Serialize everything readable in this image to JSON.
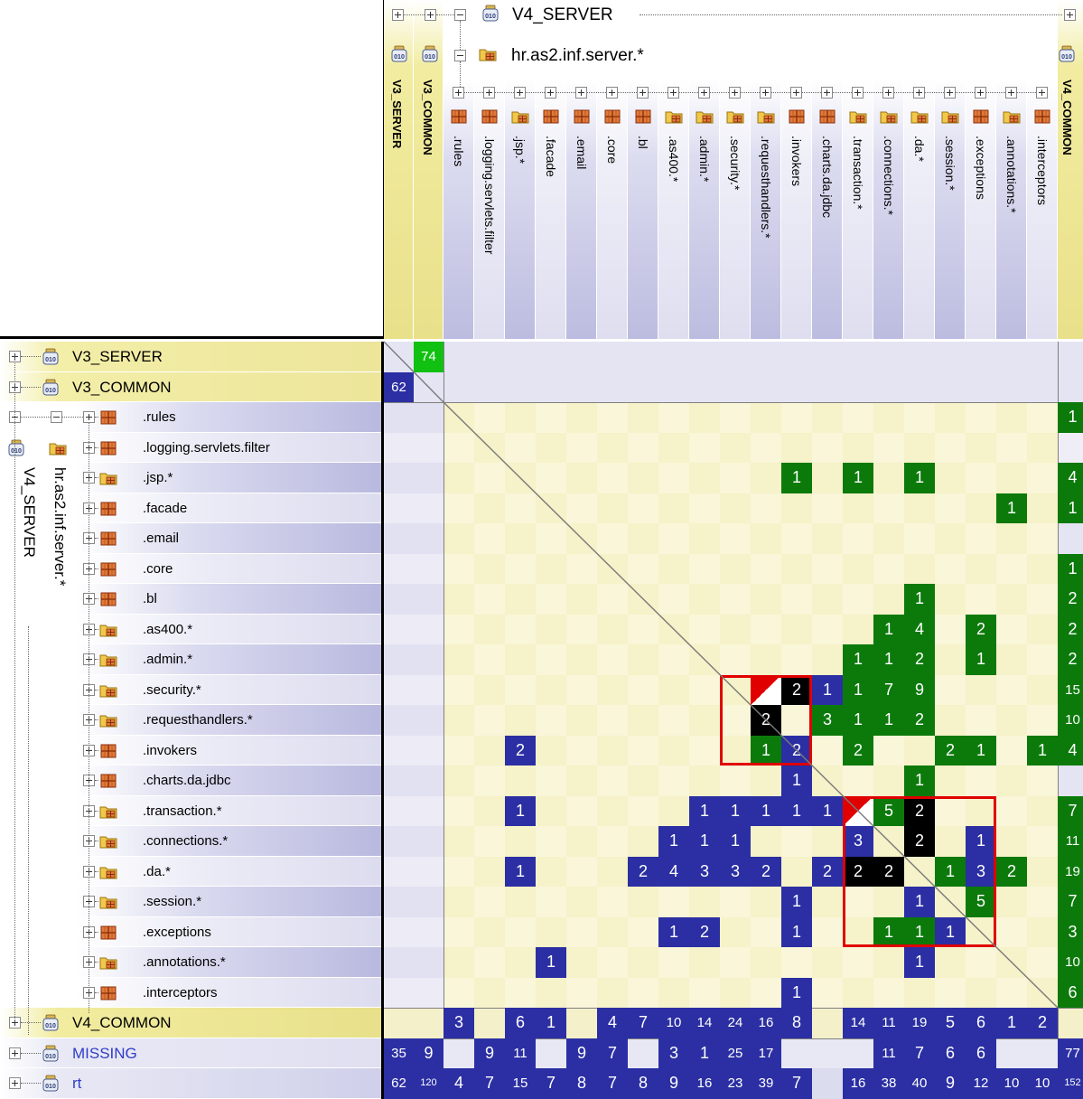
{
  "top_header": {
    "server_module": "V4_SERVER",
    "package": "hr.as2.inf.server.*",
    "left_modules": [
      "V3_SERVER",
      "V3_COMMON"
    ],
    "right_module": "V4_COMMON"
  },
  "row_tree": {
    "server_module": "V4_SERVER",
    "package": "hr.as2.inf.server.*"
  },
  "columns": [
    {
      "label": ".rules",
      "icon": "package-icon"
    },
    {
      "label": ".logging.servlets.filter",
      "icon": "package-icon"
    },
    {
      "label": ".jsp.*",
      "icon": "package-folder-icon"
    },
    {
      "label": ".facade",
      "icon": "package-icon"
    },
    {
      "label": ".email",
      "icon": "package-icon"
    },
    {
      "label": ".core",
      "icon": "package-icon"
    },
    {
      "label": ".bl",
      "icon": "package-icon"
    },
    {
      "label": ".as400.*",
      "icon": "package-folder-icon"
    },
    {
      "label": ".admin.*",
      "icon": "package-folder-icon"
    },
    {
      "label": ".security.*",
      "icon": "package-folder-icon"
    },
    {
      "label": ".requesthandlers.*",
      "icon": "package-folder-icon"
    },
    {
      "label": ".invokers",
      "icon": "package-icon"
    },
    {
      "label": ".charts.da.jdbc",
      "icon": "package-icon"
    },
    {
      "label": ".transaction.*",
      "icon": "package-folder-icon"
    },
    {
      "label": ".connections.*",
      "icon": "package-folder-icon"
    },
    {
      "label": ".da.*",
      "icon": "package-folder-icon"
    },
    {
      "label": ".session.*",
      "icon": "package-folder-icon"
    },
    {
      "label": ".exceptions",
      "icon": "package-icon"
    },
    {
      "label": ".annotations.*",
      "icon": "package-folder-icon"
    },
    {
      "label": ".interceptors",
      "icon": "package-icon"
    }
  ],
  "rows": [
    {
      "label": "V3_SERVER",
      "kind": "module"
    },
    {
      "label": "V3_COMMON",
      "kind": "module"
    },
    {
      "label": ".rules",
      "kind": "package"
    },
    {
      "label": ".logging.servlets.filter",
      "kind": "package"
    },
    {
      "label": ".jsp.*",
      "kind": "folder"
    },
    {
      "label": ".facade",
      "kind": "package"
    },
    {
      "label": ".email",
      "kind": "package"
    },
    {
      "label": ".core",
      "kind": "package"
    },
    {
      "label": ".bl",
      "kind": "package"
    },
    {
      "label": ".as400.*",
      "kind": "folder"
    },
    {
      "label": ".admin.*",
      "kind": "folder"
    },
    {
      "label": ".security.*",
      "kind": "folder"
    },
    {
      "label": ".requesthandlers.*",
      "kind": "folder"
    },
    {
      "label": ".invokers",
      "kind": "package"
    },
    {
      "label": ".charts.da.jdbc",
      "kind": "package"
    },
    {
      "label": ".transaction.*",
      "kind": "folder"
    },
    {
      "label": ".connections.*",
      "kind": "folder"
    },
    {
      "label": ".da.*",
      "kind": "folder"
    },
    {
      "label": ".session.*",
      "kind": "folder"
    },
    {
      "label": ".exceptions",
      "kind": "package"
    },
    {
      "label": ".annotations.*",
      "kind": "folder"
    },
    {
      "label": ".interceptors",
      "kind": "package"
    },
    {
      "label": "V4_COMMON",
      "kind": "module"
    },
    {
      "label": "MISSING",
      "kind": "module",
      "color": "#2f3cc8"
    },
    {
      "label": "rt",
      "kind": "module",
      "color": "#2f3cc8"
    }
  ],
  "cells": [
    {
      "r": 0,
      "c": 1,
      "v": "74",
      "color": "green"
    },
    {
      "r": 1,
      "c": 0,
      "v": "62",
      "color": "blue"
    },
    {
      "r": 2,
      "c": 22,
      "v": "1",
      "color": "green"
    },
    {
      "r": 4,
      "c": 13,
      "v": "1",
      "color": "green"
    },
    {
      "r": 4,
      "c": 15,
      "v": "1",
      "color": "green"
    },
    {
      "r": 4,
      "c": 17,
      "v": "1",
      "color": "green"
    },
    {
      "r": 4,
      "c": 22,
      "v": "4",
      "color": "green"
    },
    {
      "r": 5,
      "c": 20,
      "v": "1",
      "color": "green"
    },
    {
      "r": 5,
      "c": 22,
      "v": "1",
      "color": "green"
    },
    {
      "r": 7,
      "c": 22,
      "v": "1",
      "color": "green"
    },
    {
      "r": 8,
      "c": 17,
      "v": "1",
      "color": "green"
    },
    {
      "r": 8,
      "c": 22,
      "v": "2",
      "color": "green"
    },
    {
      "r": 9,
      "c": 16,
      "v": "1",
      "color": "green"
    },
    {
      "r": 9,
      "c": 17,
      "v": "4",
      "color": "green"
    },
    {
      "r": 9,
      "c": 19,
      "v": "2",
      "color": "green"
    },
    {
      "r": 9,
      "c": 22,
      "v": "2",
      "color": "green"
    },
    {
      "r": 10,
      "c": 15,
      "v": "1",
      "color": "green"
    },
    {
      "r": 10,
      "c": 16,
      "v": "1",
      "color": "green"
    },
    {
      "r": 10,
      "c": 17,
      "v": "2",
      "color": "green"
    },
    {
      "r": 10,
      "c": 19,
      "v": "1",
      "color": "green"
    },
    {
      "r": 10,
      "c": 22,
      "v": "2",
      "color": "green"
    },
    {
      "r": 11,
      "c": 12,
      "v": "",
      "color": "redcorner"
    },
    {
      "r": 11,
      "c": 13,
      "v": "2",
      "color": "black"
    },
    {
      "r": 11,
      "c": 14,
      "v": "1",
      "color": "blue"
    },
    {
      "r": 11,
      "c": 15,
      "v": "1",
      "color": "green"
    },
    {
      "r": 11,
      "c": 16,
      "v": "7",
      "color": "green"
    },
    {
      "r": 11,
      "c": 17,
      "v": "9",
      "color": "green"
    },
    {
      "r": 11,
      "c": 22,
      "v": "15",
      "color": "green"
    },
    {
      "r": 12,
      "c": 12,
      "v": "2",
      "color": "black"
    },
    {
      "r": 12,
      "c": 14,
      "v": "3",
      "color": "green"
    },
    {
      "r": 12,
      "c": 15,
      "v": "1",
      "color": "green"
    },
    {
      "r": 12,
      "c": 16,
      "v": "1",
      "color": "green"
    },
    {
      "r": 12,
      "c": 17,
      "v": "2",
      "color": "green"
    },
    {
      "r": 12,
      "c": 22,
      "v": "10",
      "color": "green"
    },
    {
      "r": 13,
      "c": 4,
      "v": "2",
      "color": "blue"
    },
    {
      "r": 13,
      "c": 12,
      "v": "1",
      "color": "green"
    },
    {
      "r": 13,
      "c": 13,
      "v": "2",
      "color": "blue"
    },
    {
      "r": 13,
      "c": 15,
      "v": "2",
      "color": "green"
    },
    {
      "r": 13,
      "c": 18,
      "v": "2",
      "color": "green"
    },
    {
      "r": 13,
      "c": 19,
      "v": "1",
      "color": "green"
    },
    {
      "r": 13,
      "c": 21,
      "v": "1",
      "color": "green"
    },
    {
      "r": 13,
      "c": 22,
      "v": "4",
      "color": "green"
    },
    {
      "r": 14,
      "c": 13,
      "v": "1",
      "color": "blue"
    },
    {
      "r": 14,
      "c": 17,
      "v": "1",
      "color": "green"
    },
    {
      "r": 15,
      "c": 4,
      "v": "1",
      "color": "blue"
    },
    {
      "r": 15,
      "c": 10,
      "v": "1",
      "color": "blue"
    },
    {
      "r": 15,
      "c": 11,
      "v": "1",
      "color": "blue"
    },
    {
      "r": 15,
      "c": 12,
      "v": "1",
      "color": "blue"
    },
    {
      "r": 15,
      "c": 13,
      "v": "1",
      "color": "blue"
    },
    {
      "r": 15,
      "c": 14,
      "v": "1",
      "color": "blue"
    },
    {
      "r": 15,
      "c": 15,
      "v": "",
      "color": "redcorner"
    },
    {
      "r": 15,
      "c": 16,
      "v": "5",
      "color": "green"
    },
    {
      "r": 15,
      "c": 17,
      "v": "2",
      "color": "black"
    },
    {
      "r": 15,
      "c": 22,
      "v": "7",
      "color": "green"
    },
    {
      "r": 16,
      "c": 9,
      "v": "1",
      "color": "blue"
    },
    {
      "r": 16,
      "c": 10,
      "v": "1",
      "color": "blue"
    },
    {
      "r": 16,
      "c": 11,
      "v": "1",
      "color": "blue"
    },
    {
      "r": 16,
      "c": 15,
      "v": "3",
      "color": "blue"
    },
    {
      "r": 16,
      "c": 17,
      "v": "2",
      "color": "black"
    },
    {
      "r": 16,
      "c": 19,
      "v": "1",
      "color": "blue"
    },
    {
      "r": 16,
      "c": 22,
      "v": "11",
      "color": "green"
    },
    {
      "r": 17,
      "c": 4,
      "v": "1",
      "color": "blue"
    },
    {
      "r": 17,
      "c": 8,
      "v": "2",
      "color": "blue"
    },
    {
      "r": 17,
      "c": 9,
      "v": "4",
      "color": "blue"
    },
    {
      "r": 17,
      "c": 10,
      "v": "3",
      "color": "blue"
    },
    {
      "r": 17,
      "c": 11,
      "v": "3",
      "color": "blue"
    },
    {
      "r": 17,
      "c": 12,
      "v": "2",
      "color": "blue"
    },
    {
      "r": 17,
      "c": 14,
      "v": "2",
      "color": "blue"
    },
    {
      "r": 17,
      "c": 15,
      "v": "2",
      "color": "black"
    },
    {
      "r": 17,
      "c": 16,
      "v": "2",
      "color": "black"
    },
    {
      "r": 17,
      "c": 18,
      "v": "1",
      "color": "green"
    },
    {
      "r": 17,
      "c": 19,
      "v": "3",
      "color": "blue"
    },
    {
      "r": 17,
      "c": 20,
      "v": "2",
      "color": "green"
    },
    {
      "r": 17,
      "c": 22,
      "v": "19",
      "color": "green"
    },
    {
      "r": 18,
      "c": 13,
      "v": "1",
      "color": "blue"
    },
    {
      "r": 18,
      "c": 17,
      "v": "1",
      "color": "blue"
    },
    {
      "r": 18,
      "c": 19,
      "v": "5",
      "color": "green"
    },
    {
      "r": 18,
      "c": 22,
      "v": "7",
      "color": "green"
    },
    {
      "r": 19,
      "c": 9,
      "v": "1",
      "color": "blue"
    },
    {
      "r": 19,
      "c": 10,
      "v": "2",
      "color": "blue"
    },
    {
      "r": 19,
      "c": 13,
      "v": "1",
      "color": "blue"
    },
    {
      "r": 19,
      "c": 16,
      "v": "1",
      "color": "green"
    },
    {
      "r": 19,
      "c": 17,
      "v": "1",
      "color": "green"
    },
    {
      "r": 19,
      "c": 18,
      "v": "1",
      "color": "blue"
    },
    {
      "r": 19,
      "c": 22,
      "v": "3",
      "color": "green"
    },
    {
      "r": 20,
      "c": 5,
      "v": "1",
      "color": "blue"
    },
    {
      "r": 20,
      "c": 17,
      "v": "1",
      "color": "blue"
    },
    {
      "r": 20,
      "c": 22,
      "v": "10",
      "color": "green"
    },
    {
      "r": 21,
      "c": 13,
      "v": "1",
      "color": "blue"
    },
    {
      "r": 21,
      "c": 22,
      "v": "6",
      "color": "green"
    },
    {
      "r": 22,
      "c": 2,
      "v": "3",
      "color": "blue"
    },
    {
      "r": 22,
      "c": 4,
      "v": "6",
      "color": "blue"
    },
    {
      "r": 22,
      "c": 5,
      "v": "1",
      "color": "blue"
    },
    {
      "r": 22,
      "c": 7,
      "v": "4",
      "color": "blue"
    },
    {
      "r": 22,
      "c": 8,
      "v": "7",
      "color": "blue"
    },
    {
      "r": 22,
      "c": 9,
      "v": "10",
      "color": "blue"
    },
    {
      "r": 22,
      "c": 10,
      "v": "14",
      "color": "blue"
    },
    {
      "r": 22,
      "c": 11,
      "v": "24",
      "color": "blue"
    },
    {
      "r": 22,
      "c": 12,
      "v": "16",
      "color": "blue"
    },
    {
      "r": 22,
      "c": 13,
      "v": "8",
      "color": "blue"
    },
    {
      "r": 22,
      "c": 15,
      "v": "14",
      "color": "blue"
    },
    {
      "r": 22,
      "c": 16,
      "v": "11",
      "color": "blue"
    },
    {
      "r": 22,
      "c": 17,
      "v": "19",
      "color": "blue"
    },
    {
      "r": 22,
      "c": 18,
      "v": "5",
      "color": "blue"
    },
    {
      "r": 22,
      "c": 19,
      "v": "6",
      "color": "blue"
    },
    {
      "r": 22,
      "c": 20,
      "v": "1",
      "color": "blue"
    },
    {
      "r": 22,
      "c": 21,
      "v": "2",
      "color": "blue"
    },
    {
      "r": 23,
      "c": 0,
      "v": "35",
      "color": "blue"
    },
    {
      "r": 23,
      "c": 1,
      "v": "9",
      "color": "blue"
    },
    {
      "r": 23,
      "c": 3,
      "v": "9",
      "color": "blue"
    },
    {
      "r": 23,
      "c": 4,
      "v": "11",
      "color": "blue"
    },
    {
      "r": 23,
      "c": 6,
      "v": "9",
      "color": "blue"
    },
    {
      "r": 23,
      "c": 7,
      "v": "7",
      "color": "blue"
    },
    {
      "r": 23,
      "c": 9,
      "v": "3",
      "color": "blue"
    },
    {
      "r": 23,
      "c": 10,
      "v": "1",
      "color": "blue"
    },
    {
      "r": 23,
      "c": 11,
      "v": "25",
      "color": "blue"
    },
    {
      "r": 23,
      "c": 12,
      "v": "17",
      "color": "blue"
    },
    {
      "r": 23,
      "c": 16,
      "v": "11",
      "color": "blue"
    },
    {
      "r": 23,
      "c": 17,
      "v": "7",
      "color": "blue"
    },
    {
      "r": 23,
      "c": 18,
      "v": "6",
      "color": "blue"
    },
    {
      "r": 23,
      "c": 19,
      "v": "6",
      "color": "blue"
    },
    {
      "r": 23,
      "c": 22,
      "v": "77",
      "color": "blue"
    },
    {
      "r": 24,
      "c": 0,
      "v": "62",
      "color": "blue"
    },
    {
      "r": 24,
      "c": 1,
      "v": "120",
      "color": "blue"
    },
    {
      "r": 24,
      "c": 2,
      "v": "4",
      "color": "blue"
    },
    {
      "r": 24,
      "c": 3,
      "v": "7",
      "color": "blue"
    },
    {
      "r": 24,
      "c": 4,
      "v": "15",
      "color": "blue"
    },
    {
      "r": 24,
      "c": 5,
      "v": "7",
      "color": "blue"
    },
    {
      "r": 24,
      "c": 6,
      "v": "8",
      "color": "blue"
    },
    {
      "r": 24,
      "c": 7,
      "v": "7",
      "color": "blue"
    },
    {
      "r": 24,
      "c": 8,
      "v": "8",
      "color": "blue"
    },
    {
      "r": 24,
      "c": 9,
      "v": "9",
      "color": "blue"
    },
    {
      "r": 24,
      "c": 10,
      "v": "16",
      "color": "blue"
    },
    {
      "r": 24,
      "c": 11,
      "v": "23",
      "color": "blue"
    },
    {
      "r": 24,
      "c": 12,
      "v": "39",
      "color": "blue"
    },
    {
      "r": 24,
      "c": 13,
      "v": "7",
      "color": "blue"
    },
    {
      "r": 24,
      "c": 15,
      "v": "16",
      "color": "blue"
    },
    {
      "r": 24,
      "c": 16,
      "v": "38",
      "color": "blue"
    },
    {
      "r": 24,
      "c": 17,
      "v": "40",
      "color": "blue"
    },
    {
      "r": 24,
      "c": 18,
      "v": "9",
      "color": "blue"
    },
    {
      "r": 24,
      "c": 19,
      "v": "12",
      "color": "blue"
    },
    {
      "r": 24,
      "c": 20,
      "v": "10",
      "color": "blue"
    },
    {
      "r": 24,
      "c": 21,
      "v": "10",
      "color": "blue"
    },
    {
      "r": 24,
      "c": 22,
      "v": "152",
      "color": "blue"
    }
  ],
  "cycle_groups": [
    {
      "from": 11,
      "to": 13
    },
    {
      "from": 15,
      "to": 19
    }
  ],
  "colors": {
    "green": "#0b7a0b",
    "bright_green": "#11c111",
    "blue": "#2b2fa3",
    "black": "#000000",
    "red": "#e00000",
    "module_yellow": "#f2eeb0",
    "package_lavender": "#c6c6e6",
    "matrix_yellow": "#f7f3cf"
  }
}
